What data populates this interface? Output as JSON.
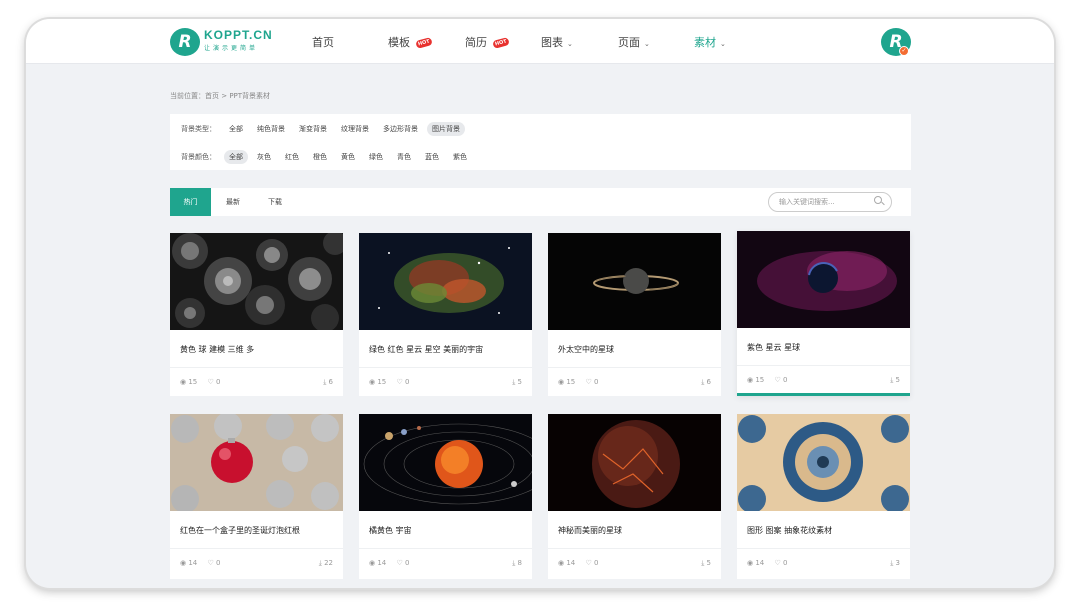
{
  "brand": {
    "title": "KOPPT.CN",
    "slogan": "让演示更简单",
    "logo_letter": "R"
  },
  "nav": [
    {
      "label": "首页",
      "hot": false,
      "dropdown": false
    },
    {
      "label": "模板",
      "hot": true,
      "dropdown": false
    },
    {
      "label": "简历",
      "hot": true,
      "dropdown": false
    },
    {
      "label": "图表",
      "hot": false,
      "dropdown": true
    },
    {
      "label": "页面",
      "hot": false,
      "dropdown": true
    },
    {
      "label": "素材",
      "hot": false,
      "dropdown": true
    }
  ],
  "hot_badge": "HOT",
  "breadcrumb": "当前位置：首页 > PPT背景素材",
  "filters": {
    "type_label": "背景类型：",
    "types": [
      "全部",
      "纯色背景",
      "渐变背景",
      "纹理背景",
      "多边形背景",
      "图片背景"
    ],
    "type_selected": 5,
    "color_label": "背景颜色：",
    "colors": [
      "全部",
      "灰色",
      "红色",
      "橙色",
      "黄色",
      "绿色",
      "青色",
      "蓝色",
      "紫色"
    ],
    "color_selected": 0
  },
  "tabs": [
    "热门",
    "最新",
    "下载"
  ],
  "search": {
    "placeholder": "输入关键词搜索..."
  },
  "cards": [
    {
      "title": "黄色 球 建模 三维 多",
      "views": "15",
      "favs": "0",
      "downloads": "6"
    },
    {
      "title": "绿色 红色 星云 星空 美丽的宇宙",
      "views": "15",
      "favs": "0",
      "downloads": "5"
    },
    {
      "title": "外太空中的星球",
      "views": "15",
      "favs": "0",
      "downloads": "6"
    },
    {
      "title": "紫色 星云 星球",
      "views": "15",
      "favs": "0",
      "downloads": "5"
    },
    {
      "title": "红色在一个盒子里的圣诞灯泡红根",
      "views": "14",
      "favs": "0",
      "downloads": "22"
    },
    {
      "title": "橘黄色 宇宙",
      "views": "14",
      "favs": "0",
      "downloads": "8"
    },
    {
      "title": "神秘而美丽的星球",
      "views": "14",
      "favs": "0",
      "downloads": "5"
    },
    {
      "title": "图形 图案 抽象花纹素材",
      "views": "14",
      "favs": "0",
      "downloads": "3"
    }
  ],
  "colors": {
    "accent": "#1fa58e",
    "background": "#f0f2f5",
    "hot": "#e8322f"
  }
}
